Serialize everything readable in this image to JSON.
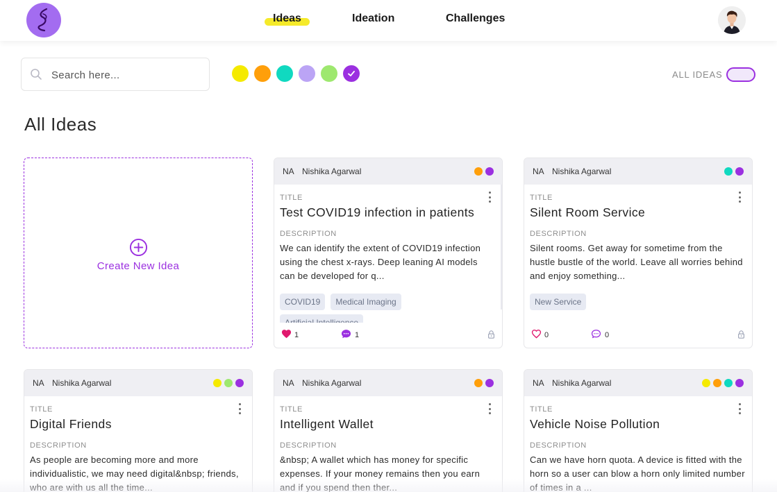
{
  "nav": {
    "links": [
      "Ideas",
      "Ideation",
      "Challenges"
    ],
    "active": "Ideas"
  },
  "search": {
    "placeholder": "Search here...",
    "value": ""
  },
  "filters": {
    "colors": [
      "#f5ea00",
      "#ff9f0a",
      "#10d9c0",
      "#bba4f5",
      "#9ee86f",
      "#9b30e0"
    ],
    "selected_color": "#9b30e0",
    "toggle_label": "ALL IDEAS",
    "toggle_on": false
  },
  "page_title": "All Ideas",
  "create_card": {
    "label": "Create New Idea"
  },
  "labels": {
    "title": "TITLE",
    "description": "DESCRIPTION"
  },
  "cards": [
    {
      "initials": "NA",
      "author": "Nishika Agarwal",
      "colors": [
        "#ff9f0a",
        "#9b30e0"
      ],
      "title": "Test COVID19 infection in patients",
      "description": "We can identify the extent of COVID19 infection using the chest x-rays. Deep leaning AI models can be developed for q...",
      "tags": [
        "COVID19",
        "Medical Imaging",
        "Artificial Intelligence"
      ],
      "likes": "1",
      "comments": "1",
      "liked": true
    },
    {
      "initials": "NA",
      "author": "Nishika Agarwal",
      "colors": [
        "#10d9c0",
        "#9b30e0"
      ],
      "title": "Silent Room Service",
      "description": "Silent rooms. Get away for sometime from the hustle bustle of the world. Leave all worries behind and enjoy something...",
      "tags": [
        "New Service"
      ],
      "likes": "0",
      "comments": "0",
      "liked": false
    },
    {
      "initials": "NA",
      "author": "Nishika Agarwal",
      "colors": [
        "#f5ea00",
        "#9ee86f",
        "#9b30e0"
      ],
      "title": "Digital Friends",
      "description": "As people are becoming more and more individualistic, we may need digital&nbsp; friends, who are with us all the time...",
      "tags": [],
      "likes": "",
      "comments": "",
      "liked": false
    },
    {
      "initials": "NA",
      "author": "Nishika Agarwal",
      "colors": [
        "#ff9f0a",
        "#9b30e0"
      ],
      "title": "Intelligent Wallet",
      "description": "&nbsp; A wallet which has money for specific expenses. If your money remains then you earn and if you spend then ther...",
      "tags": [],
      "likes": "",
      "comments": "",
      "liked": false
    },
    {
      "initials": "NA",
      "author": "Nishika Agarwal",
      "colors": [
        "#f5ea00",
        "#ff9f0a",
        "#10d9c0",
        "#9b30e0"
      ],
      "title": "Vehicle Noise Pollution",
      "description": "Can we have horn quota. A device is fitted with the horn so a user can blow a horn only limited number of times in a ...",
      "tags": [],
      "likes": "",
      "comments": "",
      "liked": false
    }
  ]
}
